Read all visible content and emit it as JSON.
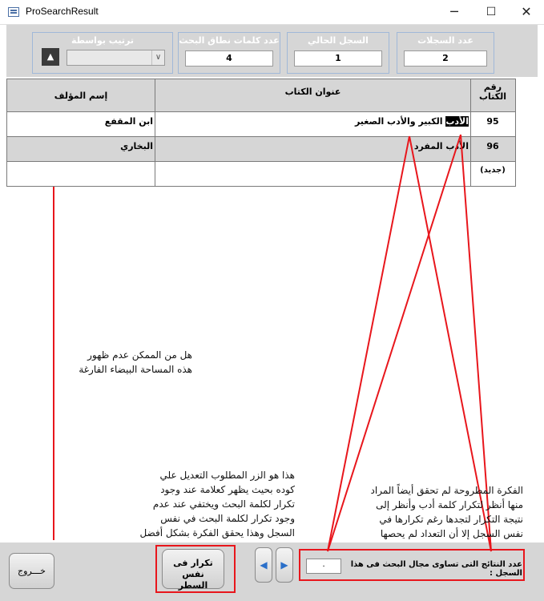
{
  "window": {
    "title": "ProSearchResult",
    "controls": {
      "minimize": "─",
      "maximize": "☐",
      "close": "✕"
    }
  },
  "header": {
    "records_label": "عدد السجلات",
    "records_value": "2",
    "current_label": "السجل الحالي",
    "current_value": "1",
    "words_label": "عدد كلمات نطاق البحث",
    "words_value": "4",
    "sort_label": "ترتيب بواسطة",
    "sort_value": "",
    "up_glyph": "▲",
    "dropdown_glyph": "∨"
  },
  "table": {
    "columns": {
      "number": "رقم الكتاب",
      "title": "عنوان الكتاب",
      "author": "إسم المؤلف"
    },
    "rows": [
      {
        "number": "95",
        "title_highlight": "الأدب",
        "title_rest": " الكبير والأدب الصغير",
        "author": "ابن المقفع"
      },
      {
        "number": "96",
        "title_highlight": "",
        "title_rest": "الأدب المفرد",
        "author": "البخاري"
      }
    ],
    "new_row_label": "(جديد)"
  },
  "bottom": {
    "exit_label": "خـــروج",
    "repeat_label_line1": "تكرار فى نفس",
    "repeat_label_line2": "السطر",
    "prev_glyph": "◀",
    "next_glyph": "▶",
    "count_label": "عدد النتائج التى تساوى مجال البحث فى هذا السجل :",
    "count_value": "٠"
  },
  "annotations": {
    "blank_area_note": [
      "هل من الممكن عدم ظهور",
      "هذه المساحة البيضاء الفارغة"
    ],
    "button_note": [
      "هذا هو الزر المطلوب التعديل علي",
      "كوده بحيث يظهر كعلامة عند وجود",
      "تكرار لكلمة البحث  ويختفي عند عدم",
      "وجود تكرار لكلمة البحث في نفس",
      "السجل وهذا يحقق الفكرة بشكل أفضل"
    ],
    "idea_note": [
      "الفكرة المطروحة لم تحقق أيضاً المراد",
      "منها أنظر لتكرار كلمة أدب وأنظر إلى",
      "نتيجة التكرار لتجدها رغم تكرارها في",
      "نفس السجل إلا أن التعداد لم يحصها"
    ],
    "accent_color": "#e8161c"
  }
}
